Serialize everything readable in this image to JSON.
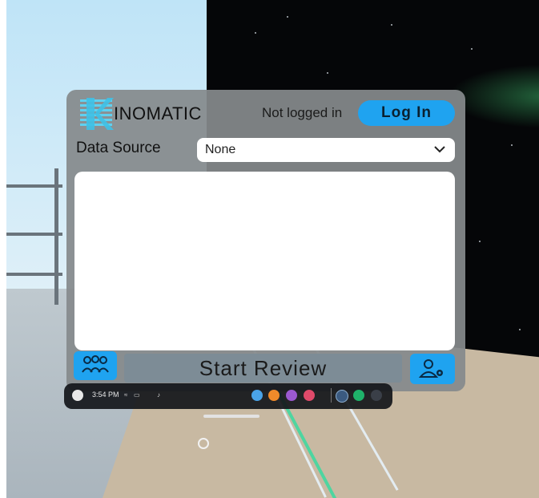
{
  "logo": {
    "text": "INOMATIC"
  },
  "header": {
    "login_status": "Not logged in",
    "login_button": "Log In"
  },
  "data_source": {
    "label": "Data Source",
    "selected": "None"
  },
  "actions": {
    "start_review": "Start Review"
  },
  "taskbar": {
    "time": "3:54 PM"
  },
  "colors": {
    "accent": "#1fa3f0",
    "panel": "#858a8c",
    "logo_accent": "#5fd1f0",
    "taskbar": "#14161a"
  },
  "icons": {
    "users": "users-icon",
    "user_settings": "user-settings-icon",
    "dropdown": "chevron-down-icon",
    "profile": "profile-icon",
    "wifi": "wifi-icon",
    "battery": "battery-icon",
    "notifications": "bell-icon",
    "home": "home-circle-icon"
  }
}
